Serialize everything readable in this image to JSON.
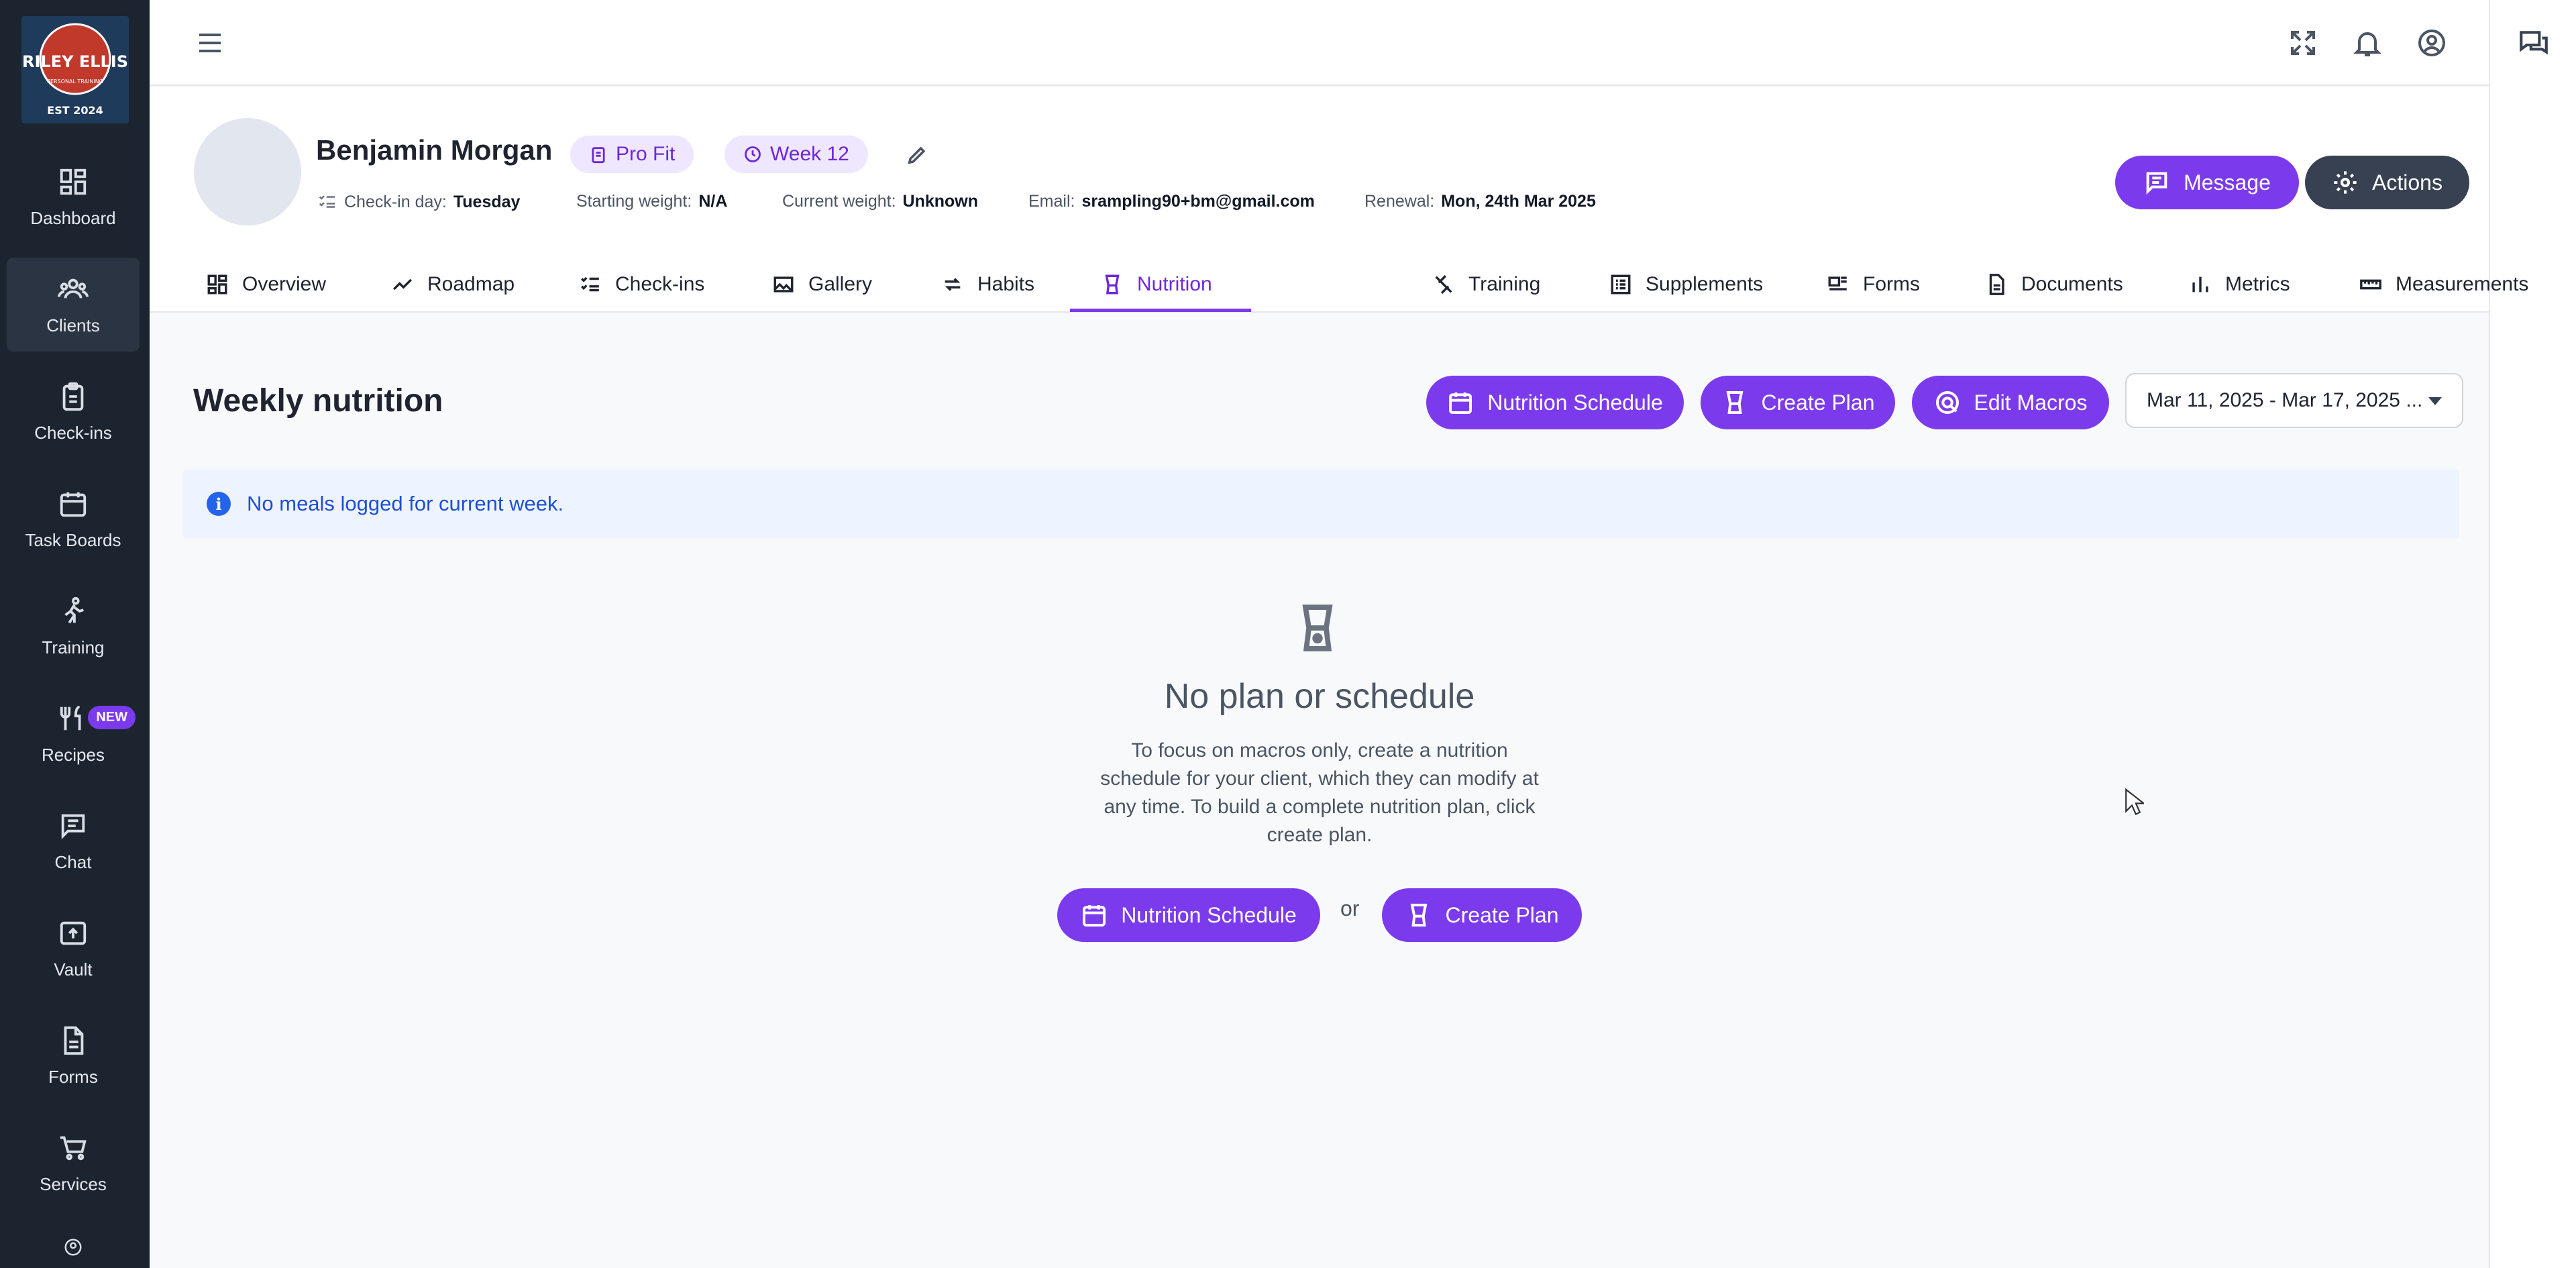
{
  "app": {
    "logo_text": "RILEY ELLIS PERSONAL TRAINING EST 2024",
    "brand_color": "#7c3aed"
  },
  "sidebar": {
    "items": [
      {
        "label": "Dashboard",
        "icon": "dashboard-icon"
      },
      {
        "label": "Clients",
        "icon": "users-icon"
      },
      {
        "label": "Check-ins",
        "icon": "clipboard-icon"
      },
      {
        "label": "Task Boards",
        "icon": "calendar-icon"
      },
      {
        "label": "Training",
        "icon": "running-icon"
      },
      {
        "label": "Recipes",
        "icon": "utensils-icon",
        "badge": "NEW"
      },
      {
        "label": "Chat",
        "icon": "chat-icon"
      },
      {
        "label": "Vault",
        "icon": "upload-icon"
      },
      {
        "label": "Forms",
        "icon": "document-icon"
      },
      {
        "label": "Services",
        "icon": "cart-icon"
      }
    ],
    "active": "Clients"
  },
  "client": {
    "name": "Benjamin Morgan",
    "plan_tag": "Pro Fit",
    "week_tag": "Week 12",
    "checkin_label": "Check-in day:",
    "checkin_value": "Tuesday",
    "start_weight_label": "Starting weight:",
    "start_weight_value": "N/A",
    "current_weight_label": "Current weight:",
    "current_weight_value": "Unknown",
    "email_label": "Email:",
    "email_value": "srampling90+bm@gmail.com",
    "renewal_label": "Renewal:",
    "renewal_value": "Mon, 24th Mar 2025"
  },
  "header_actions": {
    "message": "Message",
    "actions": "Actions"
  },
  "tabs": [
    "Overview",
    "Roadmap",
    "Check-ins",
    "Gallery",
    "Habits",
    "Nutrition",
    "Training",
    "Supplements",
    "Forms",
    "Documents",
    "Metrics",
    "Measurements"
  ],
  "active_tab": "Nutrition",
  "nutrition": {
    "title": "Weekly nutrition",
    "schedule_button": "Nutrition Schedule",
    "create_plan_button": "Create Plan",
    "edit_macros_button": "Edit Macros",
    "date_range": "Mar 11, 2025 - Mar 17, 2025 ...",
    "alert": "No meals logged for current week.",
    "empty_title": "No plan or schedule",
    "empty_text": "To focus on macros only, create a nutrition schedule for your client, which they can modify at any time. To build a complete nutrition plan, click create plan.",
    "or": "or"
  }
}
